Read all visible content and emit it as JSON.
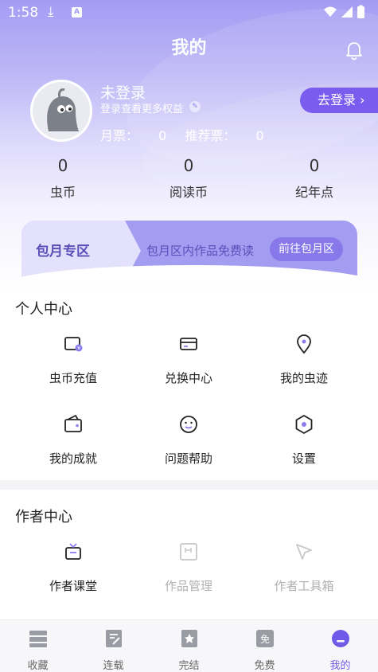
{
  "status_bar": {
    "time": "1:58",
    "download": "⤓",
    "app_icon": "A"
  },
  "header": {
    "title": "我的"
  },
  "user": {
    "name": "未登录",
    "subtitle": "登录查看更多权益",
    "monthly_ticket_label": "月票：",
    "monthly_ticket_value": "0",
    "recommend_ticket_label": "推荐票：",
    "recommend_ticket_value": "0",
    "login_button": "去登录 ›"
  },
  "stats": [
    {
      "value": "0",
      "label": "虫币"
    },
    {
      "value": "0",
      "label": "阅读币"
    },
    {
      "value": "0",
      "label": "纪年点"
    }
  ],
  "monthly": {
    "title": "包月专区",
    "desc": "包月区内作品免费读",
    "button": "前往包月区"
  },
  "personal_center": {
    "title": "个人中心",
    "items": [
      {
        "label": "虫币充值",
        "icon": "coin-wallet-icon"
      },
      {
        "label": "兑换中心",
        "icon": "card-icon"
      },
      {
        "label": "我的虫迹",
        "icon": "location-pin-icon"
      },
      {
        "label": "我的成就",
        "icon": "wallet-icon"
      },
      {
        "label": "问题帮助",
        "icon": "smile-icon"
      },
      {
        "label": "设置",
        "icon": "hexagon-settings-icon"
      }
    ]
  },
  "author_center": {
    "title": "作者中心",
    "items": [
      {
        "label": "作者课堂",
        "icon": "tv-icon"
      },
      {
        "label": "作品管理",
        "icon": "document-icon"
      },
      {
        "label": "作者工具箱",
        "icon": "cursor-icon"
      }
    ]
  },
  "tabbar": [
    {
      "label": "收藏",
      "icon": "bookshelf-icon"
    },
    {
      "label": "连载",
      "icon": "edit-book-icon"
    },
    {
      "label": "完结",
      "icon": "finished-book-icon"
    },
    {
      "label": "免费",
      "icon": "free-icon"
    },
    {
      "label": "我的",
      "icon": "profile-icon"
    }
  ],
  "colors": {
    "accent": "#6f5be8",
    "hero_top": "#a49cf3",
    "login_button": "#7a5cef"
  }
}
